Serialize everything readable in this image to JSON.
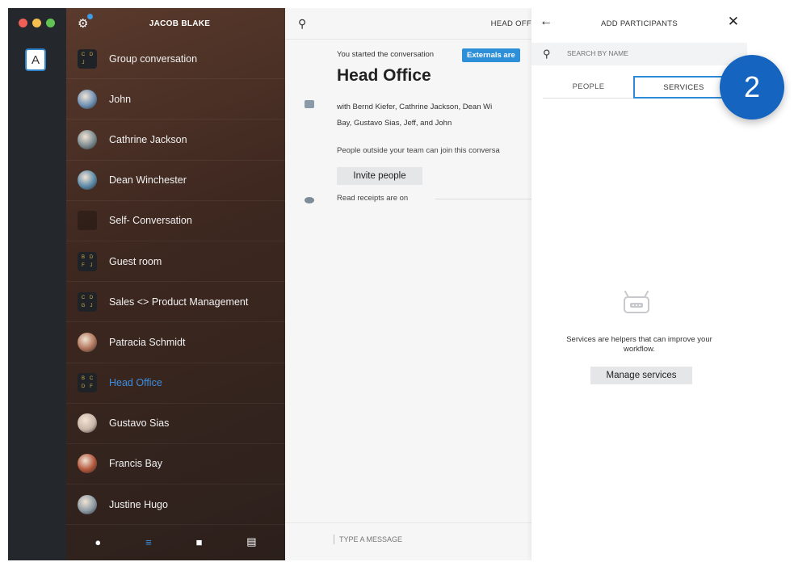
{
  "window": {
    "traffic_colors": [
      "#ee5f57",
      "#f4bf4f",
      "#61c554"
    ]
  },
  "account": {
    "initial": "A"
  },
  "sidebar": {
    "title": "JACOB BLAKE",
    "items": [
      {
        "label": "Group conversation",
        "avatar": "grid",
        "letters": [
          "C",
          "D",
          "J",
          ""
        ]
      },
      {
        "label": "John",
        "avatar": "photo",
        "color": "#6d8fb4"
      },
      {
        "label": "Cathrine Jackson",
        "avatar": "photo",
        "color": "#7a8a8f"
      },
      {
        "label": "Dean Winchester",
        "avatar": "photo",
        "color": "#5b89a8"
      },
      {
        "label": "Self- Conversation",
        "avatar": "blank"
      },
      {
        "label": "Guest room",
        "avatar": "grid",
        "letters": [
          "B",
          "D",
          "F",
          "J"
        ]
      },
      {
        "label": "Sales <> Product Management",
        "avatar": "grid",
        "letters": [
          "C",
          "D",
          "G",
          "J"
        ]
      },
      {
        "label": "Patracia Schmidt",
        "avatar": "photo",
        "color": "#b0735a"
      },
      {
        "label": "Head Office",
        "avatar": "grid",
        "letters": [
          "B",
          "C",
          "D",
          "F"
        ],
        "active": true
      },
      {
        "label": "Gustavo Sias",
        "avatar": "photo",
        "color": "#c9b6a8"
      },
      {
        "label": "Francis Bay",
        "avatar": "photo",
        "color": "#b2553a"
      },
      {
        "label": "Justine Hugo",
        "avatar": "photo",
        "color": "#8c9aa5"
      }
    ],
    "footer_icons": [
      "person-icon",
      "conversations-icon",
      "folder-icon",
      "archive-icon"
    ]
  },
  "conversation": {
    "header_title": "HEAD OFF",
    "started_text": "You started the conversation",
    "externals_badge": "Externals are",
    "name": "Head Office",
    "with_line1": "with Bernd Kiefer, Cathrine Jackson, Dean Wi",
    "with_line2": "Bay, Gustavo Sias, Jeff, and John",
    "outside_text": "People outside your team can join this conversa",
    "invite_label": "Invite people",
    "receipts_text": "Read receipts are on",
    "message_placeholder": "TYPE A MESSAGE"
  },
  "panel": {
    "title": "ADD PARTICIPANTS",
    "search_placeholder": "SEARCH BY NAME",
    "tabs": {
      "people": "PEOPLE",
      "services": "SERVICES"
    },
    "empty_text": "Services are helpers that can improve your workflow.",
    "manage_label": "Manage services"
  },
  "step_marker": "2",
  "colors": {
    "accent": "#2e8fd9",
    "marker": "#1565c0"
  }
}
